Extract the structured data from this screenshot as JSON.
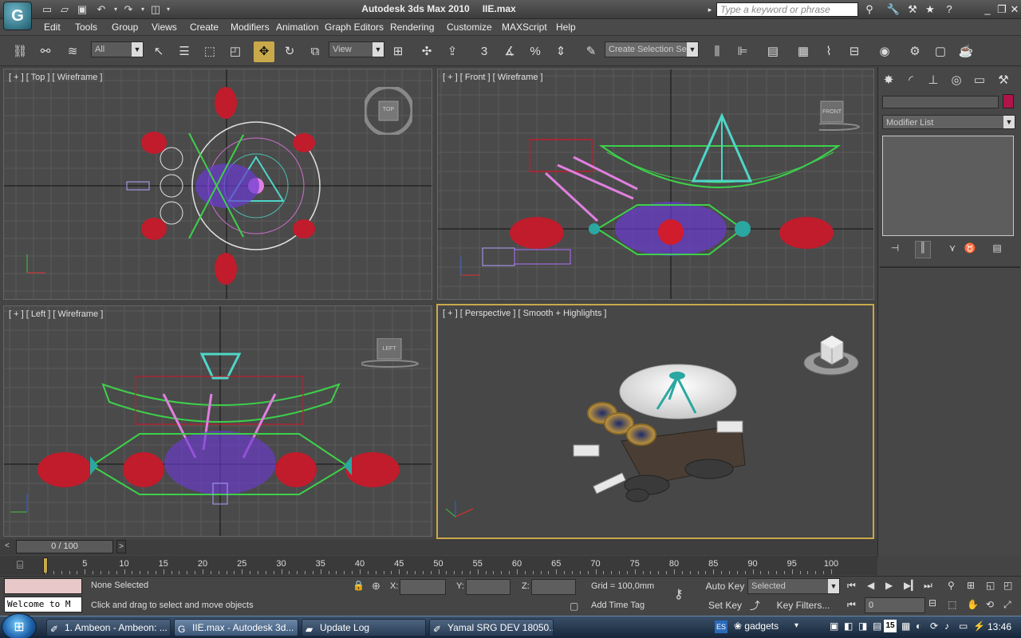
{
  "window": {
    "app_name": "Autodesk 3ds Max  2010",
    "file_name": "IIE.max",
    "search_placeholder": "Type a keyword or phrase"
  },
  "menu": [
    "Edit",
    "Tools",
    "Group",
    "Views",
    "Create",
    "Modifiers",
    "Animation",
    "Graph Editors",
    "Rendering",
    "Customize",
    "MAXScript",
    "Help"
  ],
  "toolbar": {
    "filter_value": "All",
    "coord_value": "View",
    "selection_set_placeholder": "Create Selection Se"
  },
  "viewports": {
    "top": {
      "label": "[ + ] [ Top ] [ Wireframe ]",
      "cube_label": "TOP"
    },
    "front": {
      "label": "[ + ] [ Front ] [ Wireframe ]",
      "cube_label": "FRONT"
    },
    "left": {
      "label": "[ + ] [ Left ] [ Wireframe ]",
      "cube_label": "LEFT"
    },
    "perspective": {
      "label": "[ + ] [ Perspective ] [ Smooth + Highlights ]"
    }
  },
  "command_panel": {
    "modifier_list": "Modifier List",
    "object_color": "#b0144a"
  },
  "time": {
    "slider_value": "0 / 100",
    "ticks": [
      "5",
      "10",
      "15",
      "20",
      "25",
      "30",
      "35",
      "40",
      "45",
      "50",
      "55",
      "60",
      "65",
      "70",
      "75",
      "80",
      "85",
      "90",
      "95",
      "100"
    ]
  },
  "status": {
    "maxscript_text": "Welcome to M",
    "selection": "None Selected",
    "prompt": "Click and drag to select and move objects",
    "x_label": "X:",
    "y_label": "Y:",
    "z_label": "Z:",
    "grid": "Grid = 100,0mm",
    "add_time_tag": "Add Time Tag",
    "auto_key": "Auto Key",
    "set_key": "Set Key",
    "key_mode": "Selected",
    "key_filters": "Key Filters...",
    "frame": "0"
  },
  "taskbar": {
    "tasks": [
      "1. Ambeon - Ambeon: ...",
      "IIE.max - Autodesk 3d...",
      "Update Log",
      "Yamal SRG DEV 18050..."
    ],
    "language": "ES",
    "gadgets": "gadgets",
    "date_badge": "15",
    "clock": "13:46"
  }
}
